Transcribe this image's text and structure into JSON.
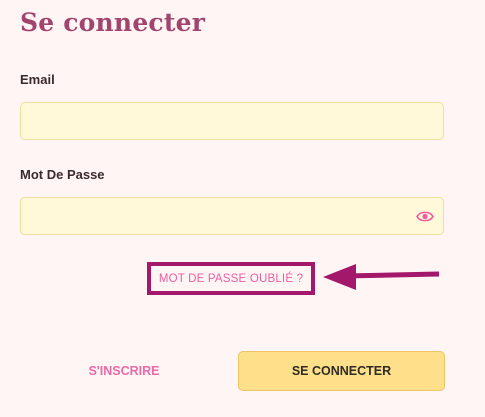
{
  "form": {
    "title": "Se connecter",
    "email_label": "Email",
    "email_value": "",
    "password_label": "Mot De Passe",
    "password_value": "",
    "forgot_password": "MOT DE PASSE OUBLIÉ ?",
    "signup_label": "S'INSCRIRE",
    "login_label": "SE CONNECTER"
  },
  "icons": {
    "password_toggle": "eye-icon",
    "annotation_arrow": "arrow-left-icon"
  },
  "colors": {
    "background": "#fff5f5",
    "title": "#a2456e",
    "input_bg": "#fff9d9",
    "accent_pink": "#ec5d9e",
    "highlight": "#a3186a",
    "button_bg": "#ffe08a"
  }
}
